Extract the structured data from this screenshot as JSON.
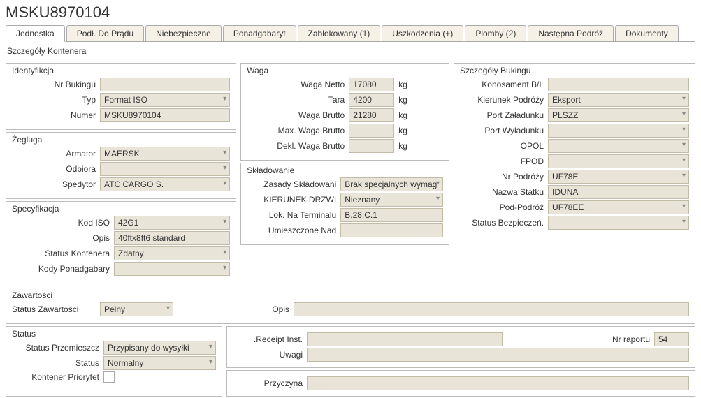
{
  "title": "MSKU8970104",
  "tabs": [
    "Jednostka",
    "Podł. Do Prądu",
    "Niebezpieczne",
    "Ponadgabaryt",
    "Zablokowany (1)",
    "Uszkodzenia (+)",
    "Plomby (2)",
    "Następna Podróż",
    "Dokumenty"
  ],
  "section_header": "Szczegóły Kontenera",
  "ident": {
    "title": "Identyfikcja",
    "nr_bukingu_lbl": "Nr Bukingu",
    "nr_bukingu": "",
    "typ_lbl": "Typ",
    "typ": "Format ISO",
    "numer_lbl": "Numer",
    "numer": "MSKU8970104"
  },
  "zegluga": {
    "title": "Żegluga",
    "armator_lbl": "Armator",
    "armator": "MAERSK",
    "odbiora_lbl": "Odbiora",
    "odbiora": "",
    "spedytor_lbl": "Spedytor",
    "spedytor": "ATC CARGO S."
  },
  "spec": {
    "title": "Specyfikacja",
    "kod_iso_lbl": "Kod ISO",
    "kod_iso": "42G1",
    "opis_lbl": "Opis",
    "opis": "40ftx8ft6 standard",
    "status_kontenera_lbl": "Status Kontenera",
    "status_kontenera": "Zdatny",
    "kody_ponadgabary_lbl": "Kody Ponadgabary",
    "kody_ponadgabary": ""
  },
  "waga": {
    "title": "Waga",
    "waga_netto_lbl": "Waga Netto",
    "waga_netto": "17080",
    "tara_lbl": "Tara",
    "tara": "4200",
    "waga_brutto_lbl": "Waga Brutto",
    "waga_brutto": "21280",
    "max_waga_brutto_lbl": "Max. Waga Brutto",
    "max_waga_brutto": "",
    "dekl_waga_brutto_lbl": "Dekl. Waga Brutto",
    "dekl_waga_brutto": "",
    "unit": "kg"
  },
  "sklad": {
    "title": "Składowanie",
    "zasady_lbl": "Zasady Składowani",
    "zasady": "Brak specjalnych wymag",
    "kierunek_lbl": "KIERUNEK DRZWI",
    "kierunek": "Nieznany",
    "lok_lbl": "Lok. Na Terminalu",
    "lok": "B.28.C.1",
    "umieszczone_lbl": "Umieszczone Nad",
    "umieszczone": ""
  },
  "bukingu": {
    "title": "Szczegóły Bukingu",
    "konosament_lbl": "Konosament B/L",
    "konosament": "",
    "kierunek_lbl": "Kierunek Podróży",
    "kierunek": "Eksport",
    "port_zalad_lbl": "Port Załadunku",
    "port_zalad": "PLSZZ",
    "port_wylad_lbl": "Port Wyładunku",
    "port_wylad": "",
    "opol_lbl": "OPOL",
    "opol": "",
    "fpod_lbl": "FPOD",
    "fpod": "",
    "nr_podrozy_lbl": "Nr Podróży",
    "nr_podrozy": "UF78E",
    "nazwa_statku_lbl": "Nazwa Statku",
    "nazwa_statku": "IDUNA",
    "pod_podroz_lbl": "Pod-Podróż",
    "pod_podroz": "UF78EE",
    "status_bezp_lbl": "Status Bezpieczeń.",
    "status_bezp": ""
  },
  "zawartosci": {
    "title": "Zawartości",
    "status_lbl": "Status Zawartości",
    "status": "Pełny",
    "opis_lbl": "Opis",
    "opis": ""
  },
  "status": {
    "title": "Status",
    "przemieszcz_lbl": "Status Przemieszcz",
    "przemieszcz": "Przypisany do wysyłki",
    "status_lbl": "Status",
    "status": "Normalny",
    "priorytet_lbl": "Kontener Priorytet",
    "receipt_lbl": ".Receipt Inst.",
    "receipt": "",
    "nr_raportu_lbl": "Nr raportu",
    "nr_raportu": "54",
    "uwagi_lbl": "Uwagi",
    "uwagi": "",
    "przyczyna_lbl": "Przyczyna",
    "przyczyna": ""
  }
}
